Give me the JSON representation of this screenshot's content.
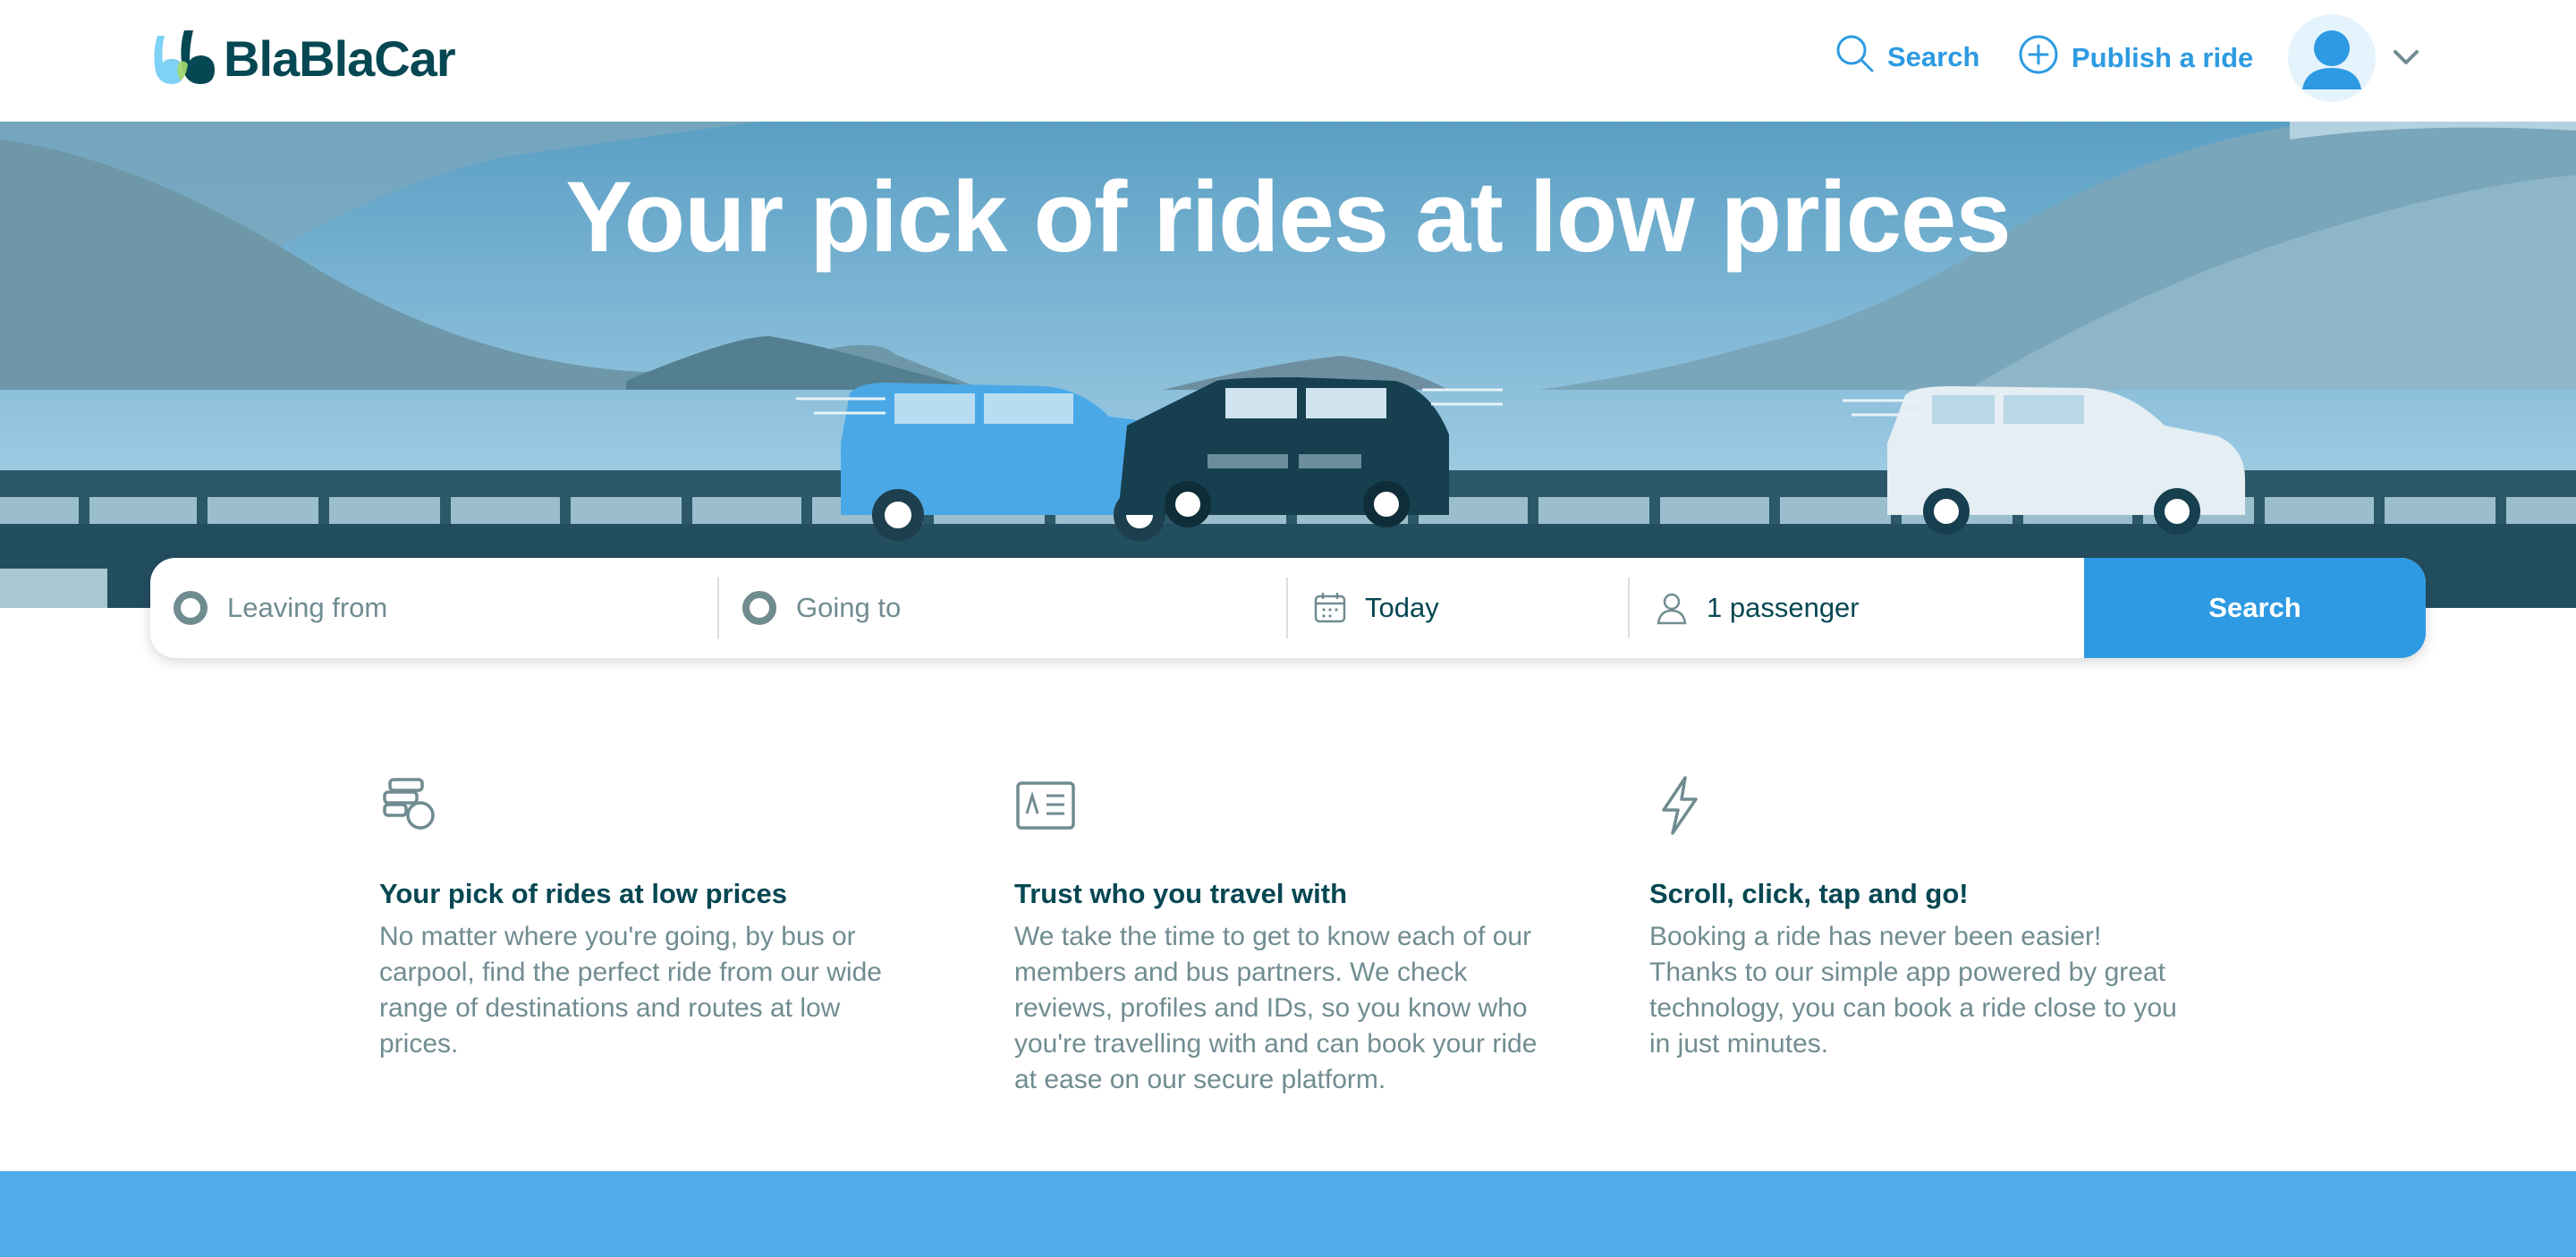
{
  "brand": {
    "name": "BlaBlaCar",
    "colors": {
      "primary": "#2d9ae3",
      "dark": "#054752",
      "muted": "#708c91",
      "band": "#4fabea"
    }
  },
  "header": {
    "search_label": "Search",
    "publish_label": "Publish a ride",
    "icons": {
      "search": "search-icon",
      "publish": "plus-circle-icon",
      "avatar": "user-avatar-icon",
      "menu": "chevron-down-icon"
    }
  },
  "hero": {
    "title": "Your pick of rides at low prices"
  },
  "search_form": {
    "leaving_placeholder": "Leaving from",
    "going_placeholder": "Going to",
    "date_value": "Today",
    "passengers_value": "1 passenger",
    "submit_label": "Search"
  },
  "features": [
    {
      "icon": "coins-icon",
      "title": "Your pick of rides at low prices",
      "text": "No matter where you're going, by bus or carpool, find the perfect ride from our wide range of destinations and routes at low prices."
    },
    {
      "icon": "id-card-icon",
      "title": "Trust who you travel with",
      "text": "We take the time to get to know each of our members and bus partners. We check reviews, profiles and IDs, so you know who you're travelling with and can book your ride at ease on our secure platform."
    },
    {
      "icon": "lightning-icon",
      "title": "Scroll, click, tap and go!",
      "text": "Booking a ride has never been easier! Thanks to our simple app powered by great technology, you can book a ride close to you in just minutes."
    }
  ]
}
